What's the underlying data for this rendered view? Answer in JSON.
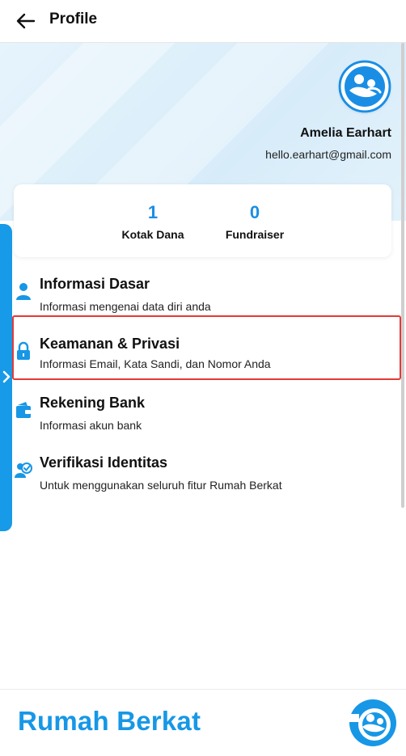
{
  "header": {
    "title": "Profile"
  },
  "profile": {
    "name": "Amelia Earhart",
    "email": "hello.earhart@gmail.com"
  },
  "stats": [
    {
      "value": "1",
      "label": "Kotak Dana"
    },
    {
      "value": "0",
      "label": "Fundraiser"
    }
  ],
  "menu": [
    {
      "icon": "user-icon",
      "title": "Informasi Dasar",
      "subtitle": "Informasi mengenai data diri anda"
    },
    {
      "icon": "lock-icon",
      "title": "Keamanan & Privasi",
      "subtitle": "Informasi Email, Kata Sandi, dan Nomor Anda"
    },
    {
      "icon": "wallet-icon",
      "title": "Rekening Bank",
      "subtitle": "Informasi akun bank"
    },
    {
      "icon": "verified-user-icon",
      "title": "Verifikasi Identitas",
      "subtitle": "Untuk menggunakan seluruh fitur Rumah Berkat"
    }
  ],
  "footer": {
    "brand": "Rumah Berkat"
  },
  "colors": {
    "accent": "#1797e6",
    "highlight": "#e53935"
  }
}
